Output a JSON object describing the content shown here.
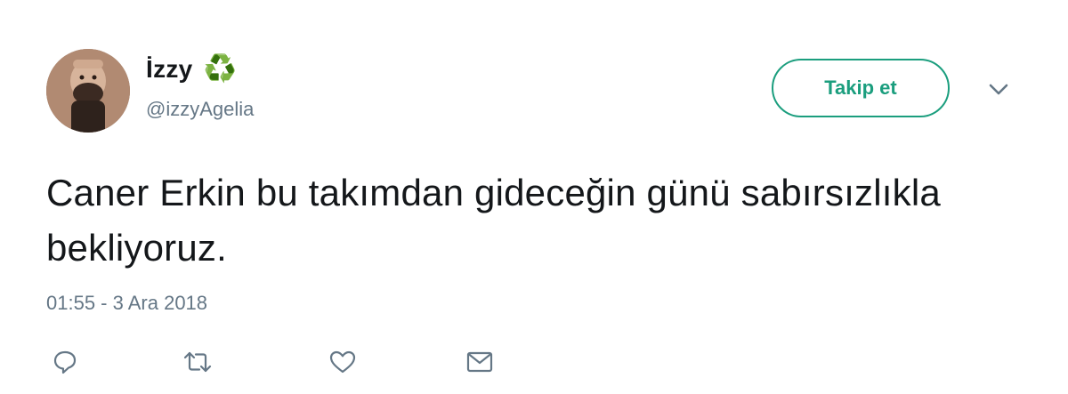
{
  "author": {
    "display_name": "İzzy",
    "name_emoji": "♻️",
    "handle": "@izzyAgelia"
  },
  "follow_button": {
    "label": "Takip et"
  },
  "tweet": {
    "text": "Caner Erkin bu takımdan gideceğin günü sabırsızlıkla bekliyoruz.",
    "timestamp": "01:55 - 3 Ara 2018"
  },
  "icons": {
    "reply": "reply-icon",
    "retweet": "retweet-icon",
    "like": "heart-icon",
    "message": "envelope-icon",
    "menu": "chevron-down-icon",
    "name_badge": "recycle-icon"
  },
  "colors": {
    "accent": "#1b9e7e",
    "text": "#14171a",
    "muted": "#657786",
    "icon": "#657786"
  }
}
